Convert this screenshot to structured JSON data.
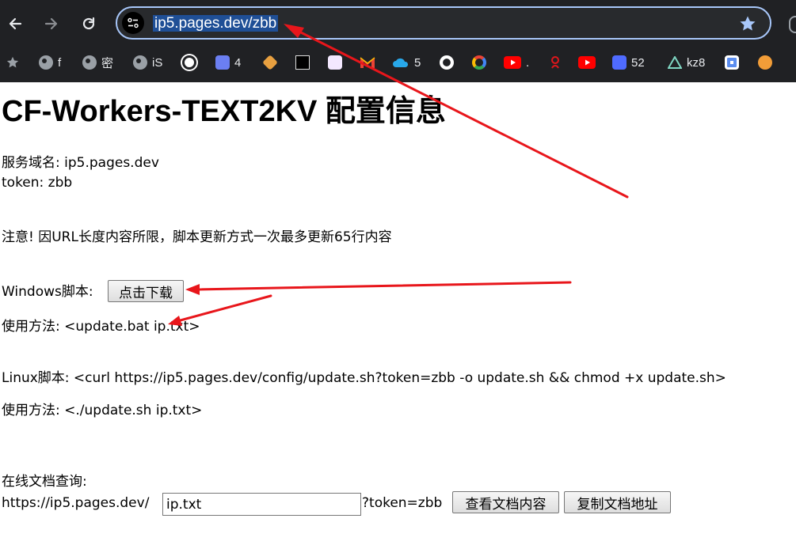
{
  "browser": {
    "url": "ip5.pages.dev/zbb",
    "nav": {
      "back_icon": "arrow-left-icon",
      "forward_icon": "arrow-right-icon",
      "reload_icon": "reload-icon"
    },
    "site_info_icon": "tune-icon",
    "bookmark_star_icon": "star-icon",
    "bookmarks": [
      {
        "label": "",
        "icon": "star-icon"
      },
      {
        "label": "f",
        "icon": "globe-icon"
      },
      {
        "label": "密",
        "icon": "globe-icon"
      },
      {
        "label": "iS",
        "icon": "globe-icon"
      },
      {
        "label": "",
        "icon": "openai-icon"
      },
      {
        "label": "4",
        "icon": "ghost-icon"
      },
      {
        "label": "",
        "icon": "hexagon-icon"
      },
      {
        "label": "",
        "icon": "pattern-icon"
      },
      {
        "label": "",
        "icon": "emoji-icon"
      },
      {
        "label": "",
        "icon": "gmail-icon"
      },
      {
        "label": "5",
        "icon": "onedrive-icon"
      },
      {
        "label": "",
        "icon": "github-icon"
      },
      {
        "label": "",
        "icon": "google-icon"
      },
      {
        "label": ".",
        "icon": "youtube-icon"
      },
      {
        "label": "",
        "icon": "red-knot-icon"
      },
      {
        "label": "",
        "icon": "youtube-icon"
      },
      {
        "label": "52",
        "icon": "c-icon"
      },
      {
        "label": "kz8",
        "icon": "triangle-icon"
      },
      {
        "label": "",
        "icon": "cluster-icon"
      },
      {
        "label": "",
        "icon": "orange-icon"
      }
    ]
  },
  "page": {
    "title": "CF-Workers-TEXT2KV 配置信息",
    "service_domain": "服务域名: ip5.pages.dev",
    "token": "token: zbb",
    "notice": "注意! 因URL长度内容所限，脚本更新方式一次最多更新65行内容",
    "windows_label": "Windows脚本:",
    "windows_download_button": "点击下载",
    "windows_usage": "使用方法: <update.bat ip.txt>",
    "linux_script": "Linux脚本: <curl https://ip5.pages.dev/config/update.sh?token=zbb -o update.sh && chmod +x update.sh>",
    "linux_usage": "使用方法: <./update.sh ip.txt>",
    "online_doc_label": "在线文档查询:",
    "doc_url_prefix": "https://ip5.pages.dev/",
    "doc_file_value": "ip.txt",
    "doc_token_suffix": "?token=zbb",
    "view_doc_button": "查看文档内容",
    "copy_doc_button": "复制文档地址"
  },
  "colors": {
    "annotation_arrow": "#e8161b",
    "chrome_bg": "#202124",
    "omnibox_border": "#a8c7fa",
    "url_highlight": "#1f4f96"
  }
}
